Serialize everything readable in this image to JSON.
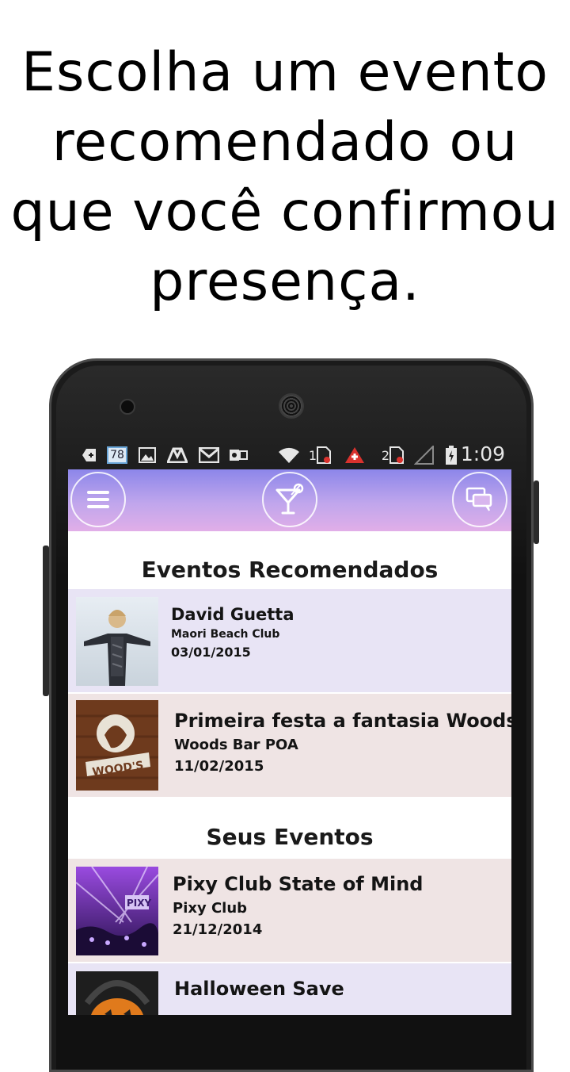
{
  "headline": {
    "lines": [
      "Escolha um evento",
      "recomendado ou",
      "que você confirmou",
      "presença."
    ]
  },
  "status_bar": {
    "badge_number": "78",
    "sim1_label": "1",
    "sim2_label": "2",
    "time": "1:09"
  },
  "app_bar": {
    "menu_icon": "hamburger-menu-icon",
    "logo_icon": "cocktail-glass-icon",
    "chat_icon": "chat-bubbles-icon",
    "gradient_top": "#8c86ea",
    "gradient_bottom": "#e1aee8"
  },
  "recommended": {
    "title": "Eventos Recomendados",
    "events": [
      {
        "title": "David Guetta",
        "venue": "Maori Beach Club",
        "date": "03/01/2015",
        "bg": "#e8e4f5"
      },
      {
        "title": "Primeira festa a fantasia Woods",
        "venue": "Woods Bar POA",
        "date": "11/02/2015",
        "bg": "#efe4e4"
      }
    ]
  },
  "my_events": {
    "title": "Seus Eventos",
    "events": [
      {
        "title": "Pixy Club State of Mind",
        "venue": "Pixy Club",
        "date": "21/12/2014",
        "bg": "#efe4e4"
      },
      {
        "title": "Halloween Save",
        "venue": "",
        "date": "",
        "bg": "#e8e4f5"
      }
    ]
  }
}
